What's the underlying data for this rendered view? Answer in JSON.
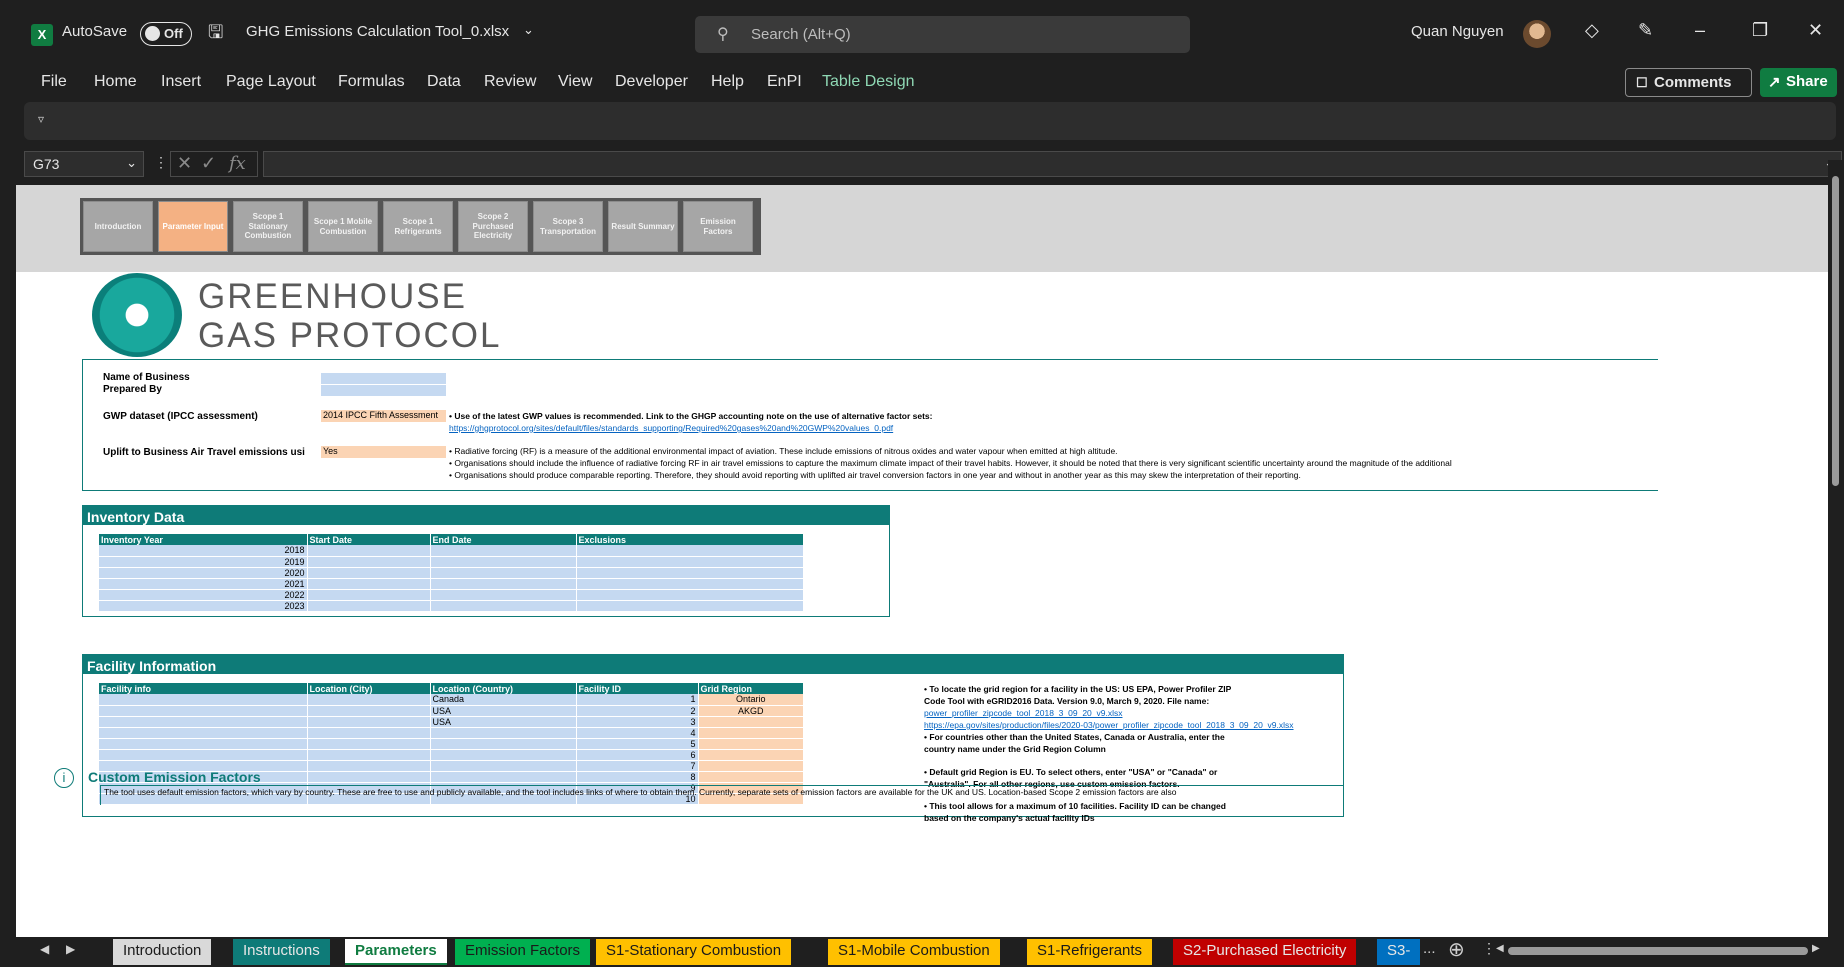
{
  "app": {
    "autosave_label": "AutoSave",
    "autosave_state": "Off",
    "file_name": "GHG Emissions Calculation Tool_0.xlsx",
    "search_placeholder": "Search (Alt+Q)",
    "user_name": "Quan Nguyen"
  },
  "menu": [
    "File",
    "Home",
    "Insert",
    "Page Layout",
    "Formulas",
    "Data",
    "Review",
    "View",
    "Developer",
    "Help",
    "EnPI",
    "Table Design"
  ],
  "buttons": {
    "comments": "Comments",
    "share": "Share"
  },
  "formula_bar": {
    "cell_ref": "G73",
    "fx": "fx",
    "value": ""
  },
  "sheet_nav": [
    "Introduction",
    "Parameter Input",
    "Scope 1 Stationary Combustion",
    "Scope 1 Mobile Combustion",
    "Scope 1 Refrigerants",
    "Scope 2 Purchased Electricity",
    "Scope 3 Transportation",
    "Result Summary",
    "Emission Factors"
  ],
  "logo": {
    "line1": "GREENHOUSE",
    "line2": "GAS PROTOCOL"
  },
  "params": {
    "name_of_business": "Name of Business",
    "prepared_by": "Prepared By",
    "gwp_label": "GWP dataset (IPCC assessment)",
    "gwp_value": "2014 IPCC Fifth Assessment",
    "gwp_note": "• Use of the latest GWP values is recommended. Link to the GHGP accounting note on the use of alternative factor sets:",
    "gwp_link": "https://ghgprotocol.org/sites/default/files/standards_supporting/Required%20gases%20and%20GWP%20values_0.pdf",
    "uplift_label": "Uplift to Business Air Travel emissions usi",
    "uplift_value": "Yes",
    "rf_notes": [
      "• Radiative forcing (RF) is a measure of the additional environmental impact of aviation. These include emissions of nitrous oxides and water vapour when emitted at high altitude.",
      "• Organisations should include the influence of radiative forcing RF in air travel emissions to capture the maximum climate impact of their travel habits. However, it should be noted that there is very significant scientific uncertainty around the magnitude of the additional",
      "• Organisations should produce comparable reporting. Therefore, they should avoid reporting with uplifted air travel conversion factors in one year and without in another year as this may skew the interpretation of their reporting."
    ]
  },
  "inventory": {
    "title": "Inventory Data",
    "headers": [
      "Inventory Year",
      "Start Date",
      "End Date",
      "Exclusions"
    ],
    "years": [
      "2018",
      "2019",
      "2020",
      "2021",
      "2022",
      "2023"
    ]
  },
  "facility": {
    "title": "Facility Information",
    "headers": [
      "Facility info",
      "Location (City)",
      "Location (Country)",
      "Facility ID",
      "Grid Region"
    ],
    "rows": [
      {
        "country": "Canada",
        "id": "1",
        "grid": "Ontario"
      },
      {
        "country": "USA",
        "id": "2",
        "grid": "AKGD"
      },
      {
        "country": "USA",
        "id": "3",
        "grid": ""
      },
      {
        "country": "",
        "id": "4",
        "grid": ""
      },
      {
        "country": "",
        "id": "5",
        "grid": ""
      },
      {
        "country": "",
        "id": "6",
        "grid": ""
      },
      {
        "country": "",
        "id": "7",
        "grid": ""
      },
      {
        "country": "",
        "id": "8",
        "grid": ""
      },
      {
        "country": "",
        "id": "9",
        "grid": ""
      },
      {
        "country": "",
        "id": "10",
        "grid": ""
      }
    ],
    "notes": {
      "n1a": "• To locate the grid region for a facility in the US: US EPA, Power Profiler ZIP",
      "n1b": "Code Tool with eGRID2016 Data. Version 9.0, March 9, 2020. File name:",
      "link1": "power_profiler_zipcode_tool_2018_3_09_20_v9.xlsx",
      "link2": "https://epa.gov/sites/production/files/2020-03/power_profiler_zipcode_tool_2018_3_09_20_v9.xlsx",
      "n2a": "• For countries other than the United States, Canada or Australia, enter the",
      "n2b": "country name under the Grid Region Column",
      "n3a": "• Default grid Region is EU. To select others, enter \"USA\" or \"Canada\" or",
      "n3b": "\"Australia\". For all other regions, use custom emission factors.",
      "n4a": "• This tool allows for a maximum of 10 facilities. Facility ID can be changed",
      "n4b": "based on the company's actual facility IDs"
    }
  },
  "custom": {
    "title": "Custom Emission Factors",
    "text": "The tool uses default emission factors, which vary by country. These are free to use and publicly available, and the tool includes links of where to obtain them. Currently, separate sets of emission factors are available for the UK and US. Location-based Scope 2 emission factors are also"
  },
  "tabs": [
    {
      "label": "Introduction",
      "color": "#d9d9d9"
    },
    {
      "label": "Instructions",
      "color": "#0e7b78"
    },
    {
      "label": "Parameters",
      "color": "#ffffff"
    },
    {
      "label": "Emission Factors",
      "color": "#00b050"
    },
    {
      "label": "S1-Stationary Combustion",
      "color": "#ffc000"
    },
    {
      "label": "S1-Mobile Combustion",
      "color": "#ffc000"
    },
    {
      "label": "S1-Refrigerants",
      "color": "#ffc000"
    },
    {
      "label": "S2-Purchased Electricity",
      "color": "#c00000"
    },
    {
      "label": "S3-",
      "color": "#0070c0"
    }
  ],
  "tab_overflow": "..."
}
